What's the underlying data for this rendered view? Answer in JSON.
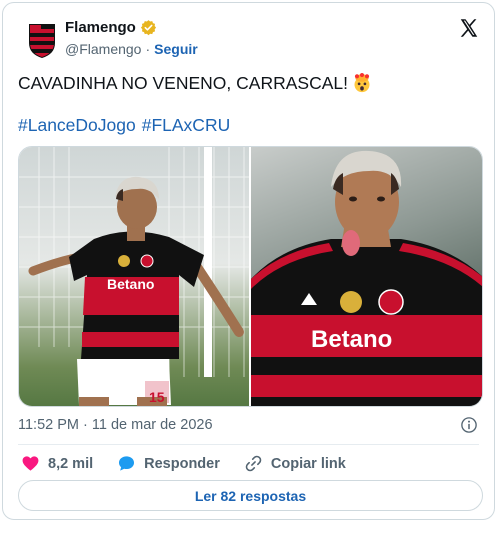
{
  "author": {
    "display_name": "Flamengo",
    "handle": "@Flamengo",
    "separator": "·",
    "follow_label": "Seguir"
  },
  "tweet": {
    "text": "CAVADINHA NO VENENO, CARRASCAL!",
    "hashtags": [
      "#LanceDoJogo",
      "#FLAxCRU"
    ]
  },
  "media": {
    "photos": [
      {
        "alt": "Player celebrating with arms outstretched"
      },
      {
        "alt": "Player sticking out tongue celebrating"
      }
    ],
    "shirt_sponsor": "Betano",
    "shirt_number": "15"
  },
  "meta": {
    "timestamp": "11:52 PM · 11 de mar de 2026"
  },
  "actions": {
    "likes": "8,2 mil",
    "reply": "Responder",
    "copy_link": "Copiar link"
  },
  "replies_button": "Ler 82 respostas",
  "colors": {
    "link": "#1d64b3",
    "like": "#f91880",
    "reply": "#1d9bf0",
    "muted": "#536471",
    "club_red": "#c8102e",
    "club_black": "#111111"
  },
  "icons": [
    "club-crest-icon",
    "verified-badge-icon",
    "x-logo-icon",
    "exploding-head-emoji-icon",
    "info-icon",
    "heart-icon",
    "reply-bubble-icon",
    "link-icon"
  ]
}
